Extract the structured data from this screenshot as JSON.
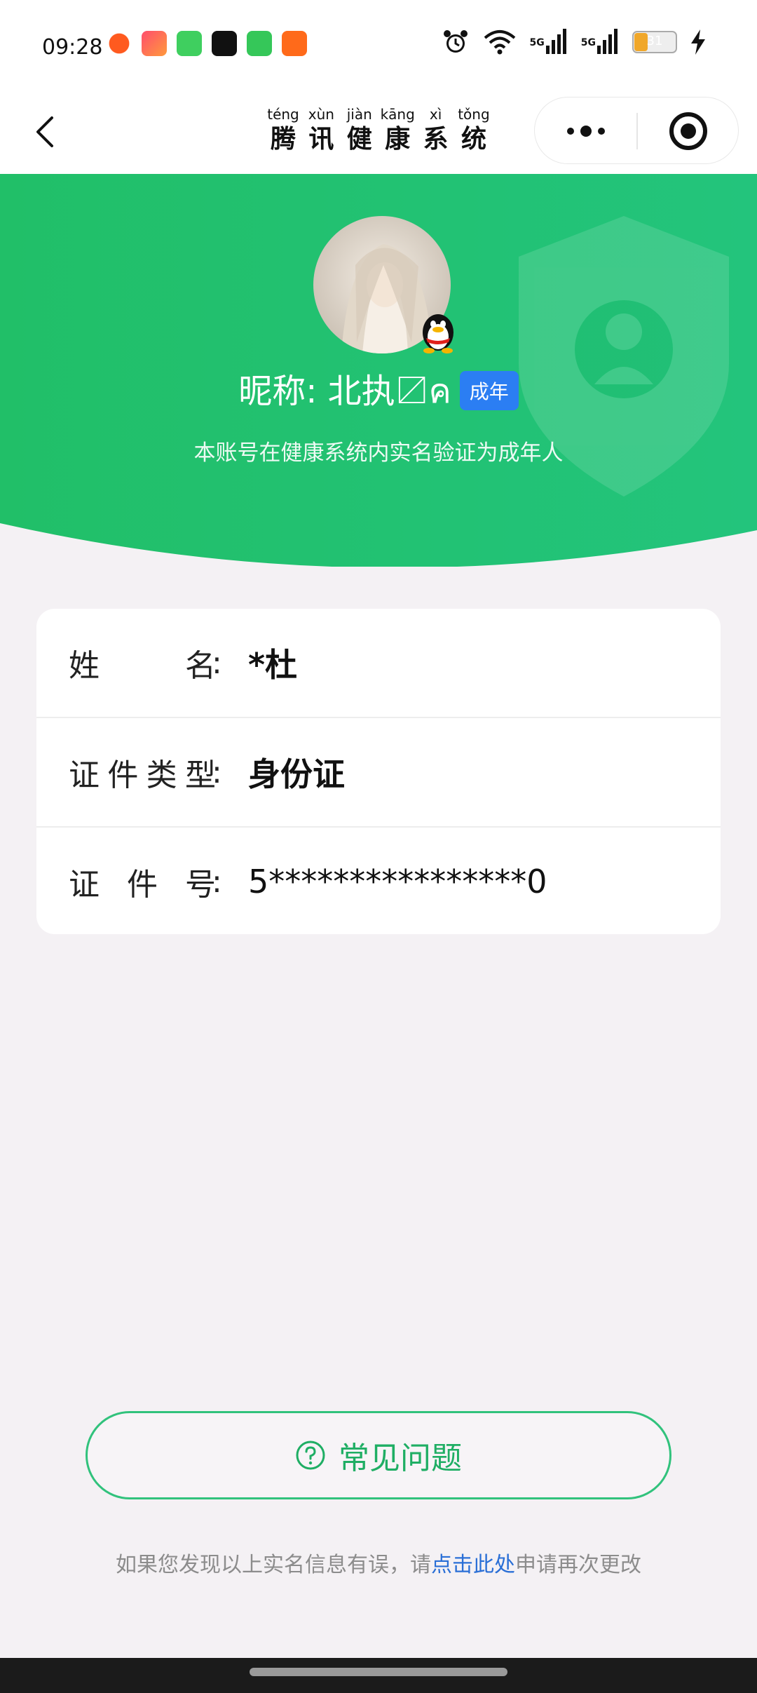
{
  "status_bar": {
    "time": "09:28",
    "network_1": "5G",
    "network_2": "5G",
    "battery_level": "31",
    "battery_fraction": 0.31,
    "icons": [
      "notification-icon",
      "shopping-app-icon",
      "messages-app-icon",
      "tiktok-app-icon",
      "phone-app-icon",
      "kuaishou-app-icon",
      "alarm-icon",
      "wifi-icon",
      "signal-icon",
      "battery-icon",
      "charging-icon"
    ]
  },
  "nav": {
    "title_chars": [
      {
        "pinyin": "téng",
        "hanzi": "腾"
      },
      {
        "pinyin": "xùn",
        "hanzi": "讯"
      },
      {
        "pinyin": "jiàn",
        "hanzi": "健"
      },
      {
        "pinyin": "kāng",
        "hanzi": "康"
      },
      {
        "pinyin": "xì",
        "hanzi": "系"
      },
      {
        "pinyin": "tǒng",
        "hanzi": "统"
      }
    ]
  },
  "profile": {
    "nickname": "昵称: 北执〼ค",
    "badge": "成年",
    "subtitle": "本账号在健康系统内实名验证为成年人"
  },
  "info": {
    "rows": [
      {
        "label_chars": [
          "姓",
          "名"
        ],
        "colon": ":",
        "value": "*杜"
      },
      {
        "label_chars": [
          "证",
          "件",
          "类",
          "型"
        ],
        "colon": ":",
        "value": "身份证"
      },
      {
        "label_chars": [
          "证",
          "件",
          "号"
        ],
        "colon": ":",
        "value": "5****************0"
      }
    ]
  },
  "faq": {
    "label": "常见问题"
  },
  "footer": {
    "before": "如果您发现以上实名信息有误，请",
    "link": "点击此处",
    "after": "申请再次更改"
  },
  "colors": {
    "brand_green": "#1fae64",
    "header_green": "#22c06d",
    "badge_blue": "#2b7ef3",
    "link_blue": "#2a6fd6"
  }
}
